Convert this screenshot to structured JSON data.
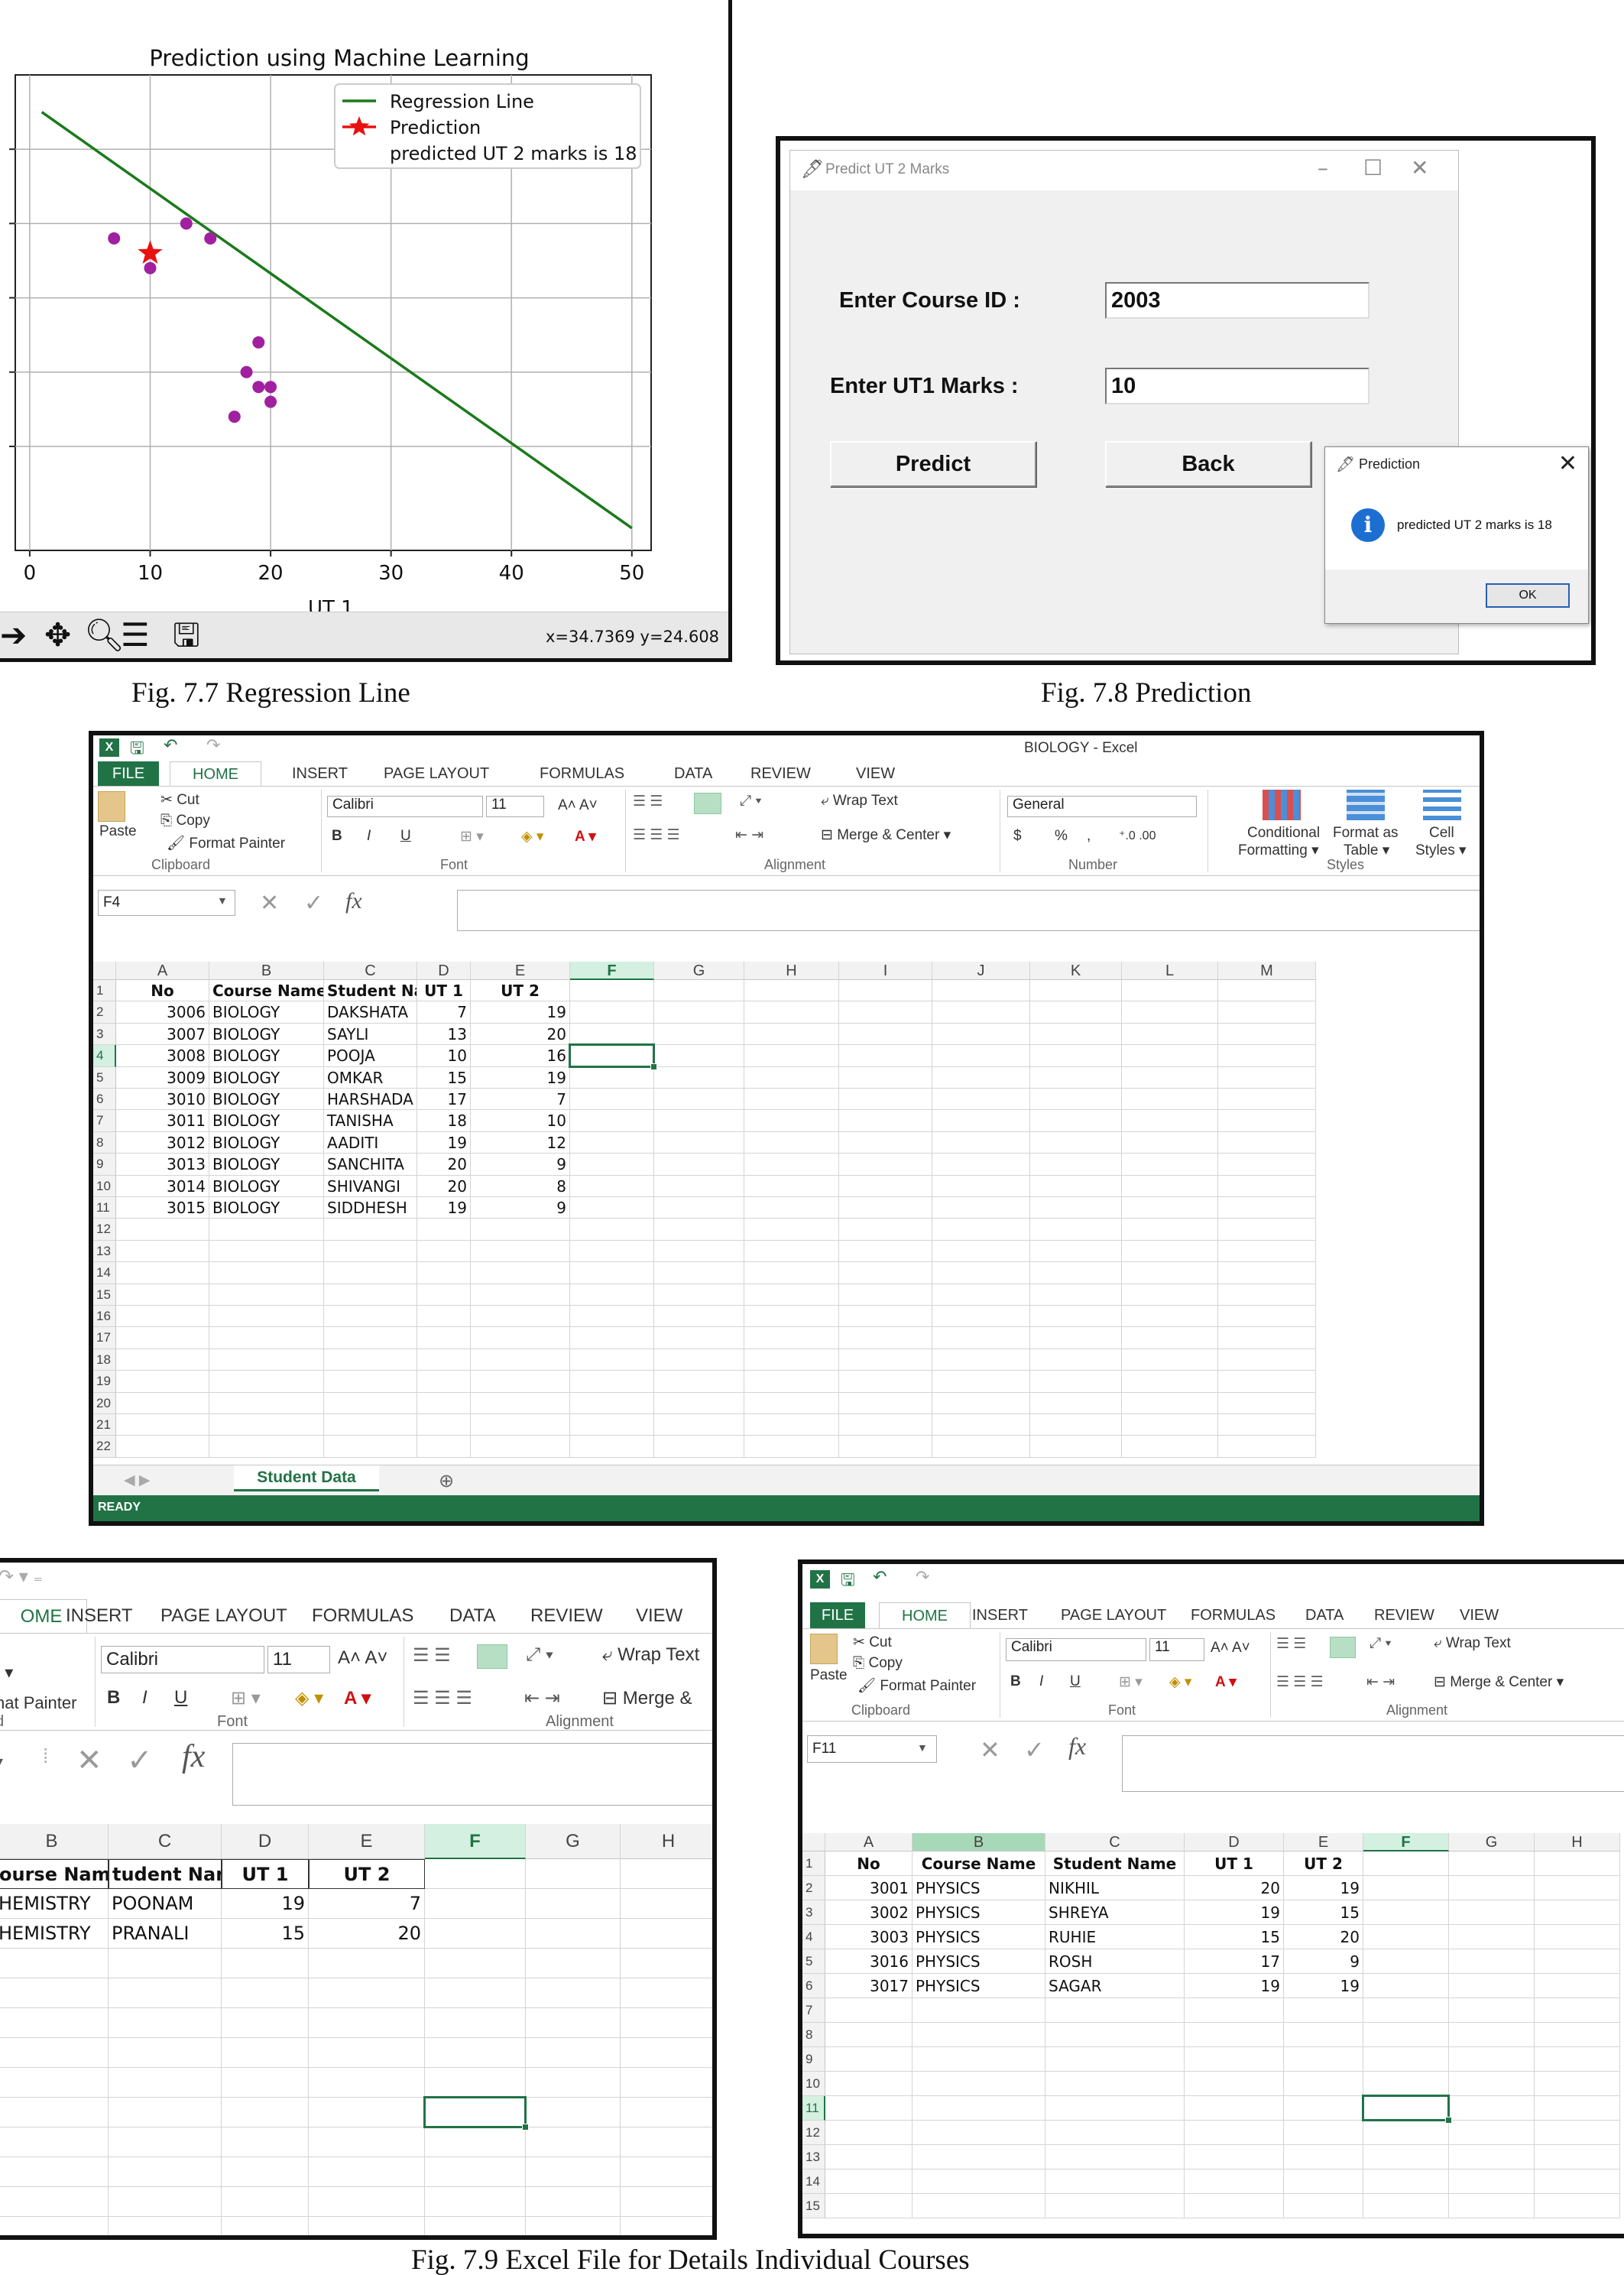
{
  "fig77": {
    "caption": "Fig. 7.7 Regression Line",
    "toolbar": {
      "coords": "x=34.7369    y=24.608"
    },
    "chart_data": {
      "type": "scatter",
      "title": "Prediction using Machine Learning",
      "xlabel": "UT 1",
      "ylabel": "",
      "xlim": [
        0,
        50
      ],
      "x_ticks": [
        "0",
        "10",
        "20",
        "30",
        "40",
        "50"
      ],
      "grid": true,
      "legend_placement": "top-right",
      "legend": [
        "Regression Line",
        "Prediction",
        "predicted UT 2 marks is 18"
      ],
      "regression_line": {
        "x": [
          1,
          50
        ],
        "y": [
          27.5,
          -0.5
        ],
        "color": "#1a7a1a"
      },
      "points": {
        "x": [
          7,
          10,
          13,
          15,
          17,
          18,
          19,
          19,
          20,
          20
        ],
        "y": [
          19,
          17,
          20,
          19,
          7,
          10,
          12,
          9,
          8,
          9
        ],
        "color": "#a020a0"
      },
      "prediction": {
        "x": 10,
        "y": 18,
        "color": "#e81010"
      }
    }
  },
  "fig78": {
    "caption": "Fig. 7.8 Prediction",
    "window_title": "Predict UT 2 Marks",
    "course_label": "Enter Course ID :",
    "course_value": "2003",
    "ut1_label": "Enter UT1 Marks :",
    "ut1_value": "10",
    "predict_button": "Predict",
    "back_button": "Back",
    "msg_title": "Prediction",
    "msg_text": "predicted UT 2 marks is 18",
    "ok_button": "OK"
  },
  "excel_bio": {
    "window_title": "BIOLOGY - Excel",
    "tabs": [
      "FILE",
      "HOME",
      "INSERT",
      "PAGE LAYOUT",
      "FORMULAS",
      "DATA",
      "REVIEW",
      "VIEW"
    ],
    "ribbon": {
      "cut": "Cut",
      "copy": "Copy",
      "format_painter": "Format Painter",
      "paste": "Paste",
      "clipboard": "Clipboard",
      "font_name": "Calibri",
      "font_size": "11",
      "font": "Font",
      "wrap_text": "Wrap Text",
      "merge_center": "Merge & Center",
      "alignment": "Alignment",
      "number_format": "General",
      "number": "Number",
      "conditional": "Conditional",
      "formatting": "Formatting",
      "format_as": "Format as",
      "table": "Table",
      "cell": "Cell",
      "styles_btn": "Styles",
      "styles": "Styles",
      "bold": "B",
      "italic": "I",
      "underline": "U",
      "currency": "$",
      "percent": "%",
      "comma": ","
    },
    "name_box": "F4",
    "columns": [
      "A",
      "B",
      "C",
      "D",
      "E",
      "F",
      "G",
      "H",
      "I",
      "J",
      "K",
      "L",
      "M"
    ],
    "header": [
      "No",
      "Course Name",
      "Student Name",
      "UT 1",
      "UT 2"
    ],
    "rows": [
      [
        "3006",
        "BIOLOGY",
        "DAKSHATA",
        "7",
        "19"
      ],
      [
        "3007",
        "BIOLOGY",
        "SAYLI",
        "13",
        "20"
      ],
      [
        "3008",
        "BIOLOGY",
        "POOJA",
        "10",
        "16"
      ],
      [
        "3009",
        "BIOLOGY",
        "OMKAR",
        "15",
        "19"
      ],
      [
        "3010",
        "BIOLOGY",
        "HARSHADA",
        "17",
        "7"
      ],
      [
        "3011",
        "BIOLOGY",
        "TANISHA",
        "18",
        "10"
      ],
      [
        "3012",
        "BIOLOGY",
        "AADITI",
        "19",
        "12"
      ],
      [
        "3013",
        "BIOLOGY",
        "SANCHITA",
        "20",
        "9"
      ],
      [
        "3014",
        "BIOLOGY",
        "SHIVANGI",
        "20",
        "8"
      ],
      [
        "3015",
        "BIOLOGY",
        "SIDDHESH",
        "19",
        "9"
      ]
    ],
    "row_numbers": [
      "1",
      "2",
      "3",
      "4",
      "5",
      "6",
      "7",
      "8",
      "9",
      "10",
      "11",
      "12",
      "13",
      "14",
      "15",
      "16",
      "17",
      "18",
      "19",
      "20",
      "21",
      "22"
    ],
    "sheet_tab": "Student Data",
    "status": "READY"
  },
  "excel_chem": {
    "tabs": [
      "OME",
      "INSERT",
      "PAGE LAYOUT",
      "FORMULAS",
      "DATA",
      "REVIEW",
      "VIEW"
    ],
    "ribbon": {
      "font_name": "Calibri",
      "font_size": "11",
      "font": "Font",
      "alignment": "Alignment",
      "wrap_text": "Wrap Text",
      "merge": "Merge &",
      "format_painter": "nat Painter",
      "clip_fragment": "d",
      "bold": "B",
      "italic": "I",
      "underline": "U"
    },
    "columns": [
      "B",
      "C",
      "D",
      "E",
      "F",
      "G",
      "H"
    ],
    "header": [
      "ourse Name",
      "tudent Nam",
      "UT 1",
      "UT 2"
    ],
    "rows": [
      [
        "HEMISTRY",
        "POONAM",
        "19",
        "7"
      ],
      [
        "HEMISTRY",
        "PRANALI",
        "15",
        "20"
      ]
    ]
  },
  "excel_phy": {
    "tabs": [
      "FILE",
      "HOME",
      "INSERT",
      "PAGE LAYOUT",
      "FORMULAS",
      "DATA",
      "REVIEW",
      "VIEW"
    ],
    "ribbon": {
      "cut": "Cut",
      "copy": "Copy",
      "format_painter": "Format Painter",
      "paste": "Paste",
      "clipboard": "Clipboard",
      "font_name": "Calibri",
      "font_size": "11",
      "font": "Font",
      "wrap_text": "Wrap Text",
      "merge_center": "Merge & Center",
      "alignment": "Alignment",
      "bold": "B",
      "italic": "I",
      "underline": "U"
    },
    "name_box": "F11",
    "columns": [
      "A",
      "B",
      "C",
      "D",
      "E",
      "F",
      "G",
      "H"
    ],
    "header": [
      "No",
      "Course Name",
      "Student Name",
      "UT 1",
      "UT 2"
    ],
    "rows": [
      [
        "3001",
        "PHYSICS",
        "NIKHIL",
        "20",
        "19"
      ],
      [
        "3002",
        "PHYSICS",
        "SHREYA",
        "19",
        "15"
      ],
      [
        "3003",
        "PHYSICS",
        "RUHIE",
        "15",
        "20"
      ],
      [
        "3016",
        "PHYSICS",
        "ROSH",
        "17",
        "9"
      ],
      [
        "3017",
        "PHYSICS",
        "SAGAR",
        "19",
        "19"
      ]
    ],
    "row_numbers": [
      "1",
      "2",
      "3",
      "4",
      "5",
      "6",
      "7",
      "8",
      "9",
      "10",
      "11",
      "12",
      "13",
      "14",
      "15"
    ]
  },
  "fig79": {
    "caption": "Fig. 7.9 Excel File for Details Individual Courses"
  }
}
